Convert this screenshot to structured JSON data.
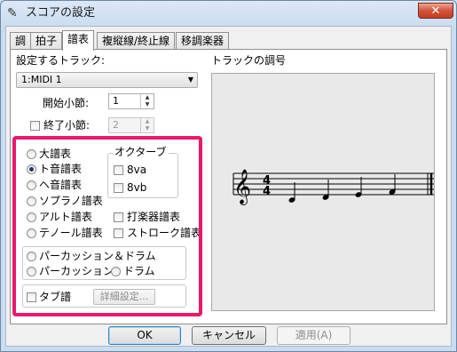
{
  "window": {
    "title": "スコアの設定",
    "close_glyph": "✕"
  },
  "tabs": [
    {
      "label": "調"
    },
    {
      "label": "拍子"
    },
    {
      "label": "譜表"
    },
    {
      "label": "複縦線/終止線"
    },
    {
      "label": "移調楽器"
    }
  ],
  "active_tab": "譜表",
  "track": {
    "label": "設定するトラック:",
    "selected": "1:MIDI 1"
  },
  "start_measure": {
    "label": "開始小節:",
    "value": "1"
  },
  "end_measure": {
    "label": "終了小節:",
    "value": "2",
    "checked": false,
    "disabled": true
  },
  "staff_types": {
    "grand": "大譜表",
    "treble": "ト音譜表",
    "bass": "ヘ音譜表",
    "soprano": "ソプラノ譜表",
    "alto": "アルト譜表",
    "tenor": "テノール譜表",
    "selected": "ト音譜表"
  },
  "octave": {
    "title": "オクターブ",
    "va": "8va",
    "vb": "8vb"
  },
  "other_staves": {
    "percussion": "打楽器譜表",
    "stroke": "ストローク譜表"
  },
  "percussion_group": {
    "perc_drum": "パーカッション＆ドラム",
    "perc": "パーカッション",
    "drum": "ドラム"
  },
  "tab": {
    "label": "タブ譜",
    "details": "詳細設定..."
  },
  "preview": {
    "label": "トラックの調号",
    "time_top": "4",
    "time_bottom": "4",
    "clef_glyph": "𝄞"
  },
  "buttons": {
    "ok": "OK",
    "cancel": "キャンセル",
    "apply": "適用(A)"
  },
  "colors": {
    "highlight": "#e8196a",
    "close": "#c33d22"
  }
}
